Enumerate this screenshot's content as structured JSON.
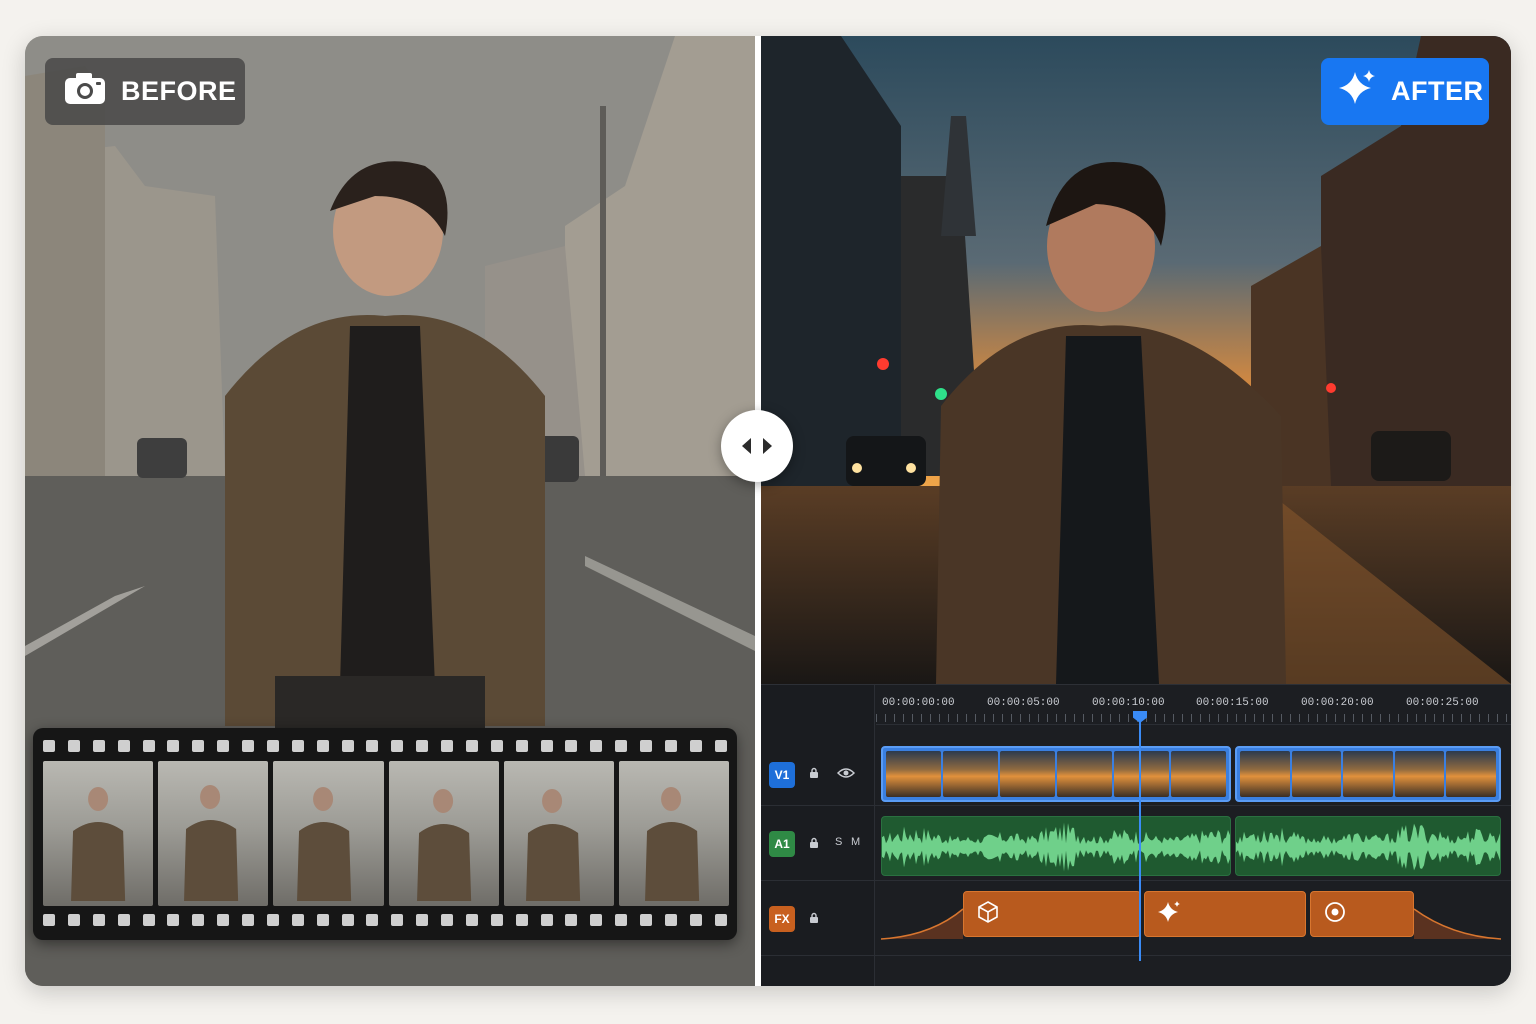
{
  "before_badge": {
    "label": "BEFORE",
    "icon": "camera-icon"
  },
  "after_badge": {
    "label": "AFTER",
    "icon": "sparkle-icon",
    "color": "#1877f2"
  },
  "compare_handle": {
    "icon": "left-right-arrows-icon"
  },
  "filmstrip": {
    "frame_count": 6
  },
  "timeline": {
    "timecodes": [
      "00:00:00:00",
      "00:00:05:00",
      "00:00:10:00",
      "00:00:15:00",
      "00:00:20:00",
      "00:00:25:00"
    ],
    "playhead_time": "00:00:10:00",
    "tracks": [
      {
        "id": "v1",
        "label": "V1",
        "color": "#1e6fd9",
        "controls": [
          "lock-icon",
          "eye-icon"
        ]
      },
      {
        "id": "a1",
        "label": "A1",
        "color": "#2f8a45",
        "controls": [
          "lock-icon",
          "S",
          "M"
        ]
      },
      {
        "id": "fx",
        "label": "FX",
        "color": "#c8601f",
        "controls": [
          "lock-icon"
        ]
      }
    ],
    "fx_clips": [
      {
        "icon": "cube-icon"
      },
      {
        "icon": "sparkle-icon"
      },
      {
        "icon": "target-icon"
      }
    ]
  }
}
